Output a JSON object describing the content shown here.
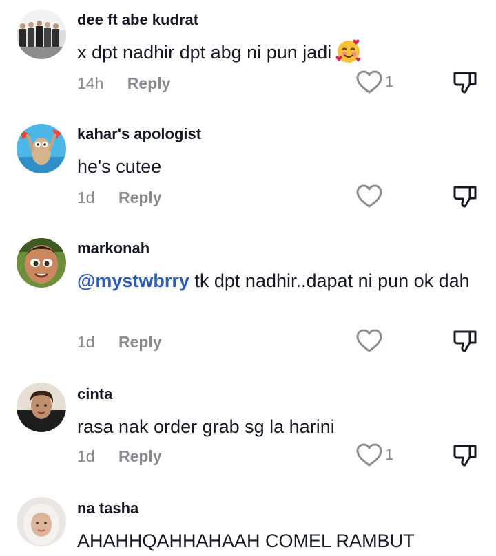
{
  "comments": [
    {
      "username": "dee ft abe kudrat",
      "text": "x dpt nadhir dpt abg ni pun jadi",
      "emoji": "smiling-face-with-hearts",
      "time": "14h",
      "reply": "Reply",
      "likes": "1"
    },
    {
      "username": "kahar's apologist",
      "text": "he's cutee",
      "time": "1d",
      "reply": "Reply",
      "likes": ""
    },
    {
      "username": "markonah",
      "mention": "@mystwbrry",
      "text": " tk dpt nadhir..dapat ni pun ok dah",
      "time": "1d",
      "reply": "Reply",
      "likes": ""
    },
    {
      "username": "cinta",
      "text": "rasa nak order grab sg la harini",
      "time": "1d",
      "reply": "Reply",
      "likes": "1"
    },
    {
      "username": "na tasha",
      "text": "AHAHHQAHHAHAAH COMEL RAMBUT",
      "time": "",
      "reply": "",
      "likes": ""
    }
  ],
  "colors": {
    "text": "#161823",
    "muted": "#8a8b91",
    "mention": "#2b5db9"
  }
}
